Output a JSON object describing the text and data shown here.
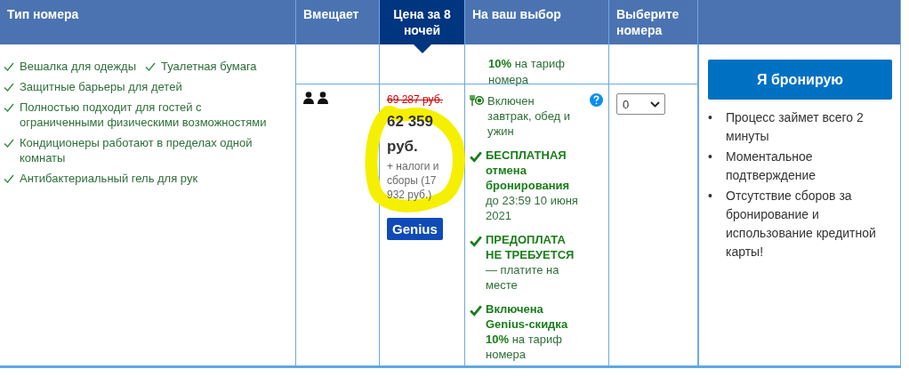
{
  "headers": [
    {
      "label": "Тип номера",
      "selected": false
    },
    {
      "label": "Вмещает",
      "selected": false
    },
    {
      "label": "Цена за 8 ночей",
      "selected": true
    },
    {
      "label": "На ваш выбор",
      "selected": false
    },
    {
      "label": "Выберите номера",
      "selected": false
    },
    {
      "selected": false
    }
  ],
  "feature_lines": [
    [
      "Вешалка для одежды",
      "Туалетная бумага"
    ],
    [
      "Защитные барьеры для детей"
    ],
    [
      "Полностью подходит для гостей с ограниченными физическими возможностями"
    ],
    [
      "Кондиционеры работают в пределах одной комнаты"
    ],
    [
      "Антибактериальный гель для рук"
    ]
  ],
  "previous_row": {
    "choice": "**10%** на тариф номера"
  },
  "room": {
    "old_price": "69 287 руб.",
    "price": "62 359 руб.",
    "taxes": "+ налоги и сборы (17 932 руб.)",
    "badge": "Genius",
    "highlighted": true,
    "conditions": [
      {
        "kind": "meal",
        "text": "Включен завтрак, обед и ужин",
        "help": true
      },
      {
        "kind": "check",
        "text": "**БЕСПЛАТНАЯ отмена бронирования** до 23:59 10 июня 2021",
        "help": false
      },
      {
        "kind": "check",
        "text": "**ПРЕДОПЛАТА НЕ ТРЕБУЕТСЯ** — платите на месте",
        "help": false
      },
      {
        "kind": "check",
        "text": "**Включена Genius-скидка 10%** на тариф номера",
        "help": false
      }
    ],
    "quantity": "0"
  },
  "booking": {
    "button": "Я бронирую",
    "bullets": [
      {
        "marker": "•",
        "text": "Процесс займет всего 2 минуты"
      },
      {
        "marker": "•",
        "text": "Моментальное подтверждение"
      },
      {
        "marker": "•",
        "text": "Отсутствие сборов за бронирование и использование кредитной карты!"
      }
    ]
  }
}
